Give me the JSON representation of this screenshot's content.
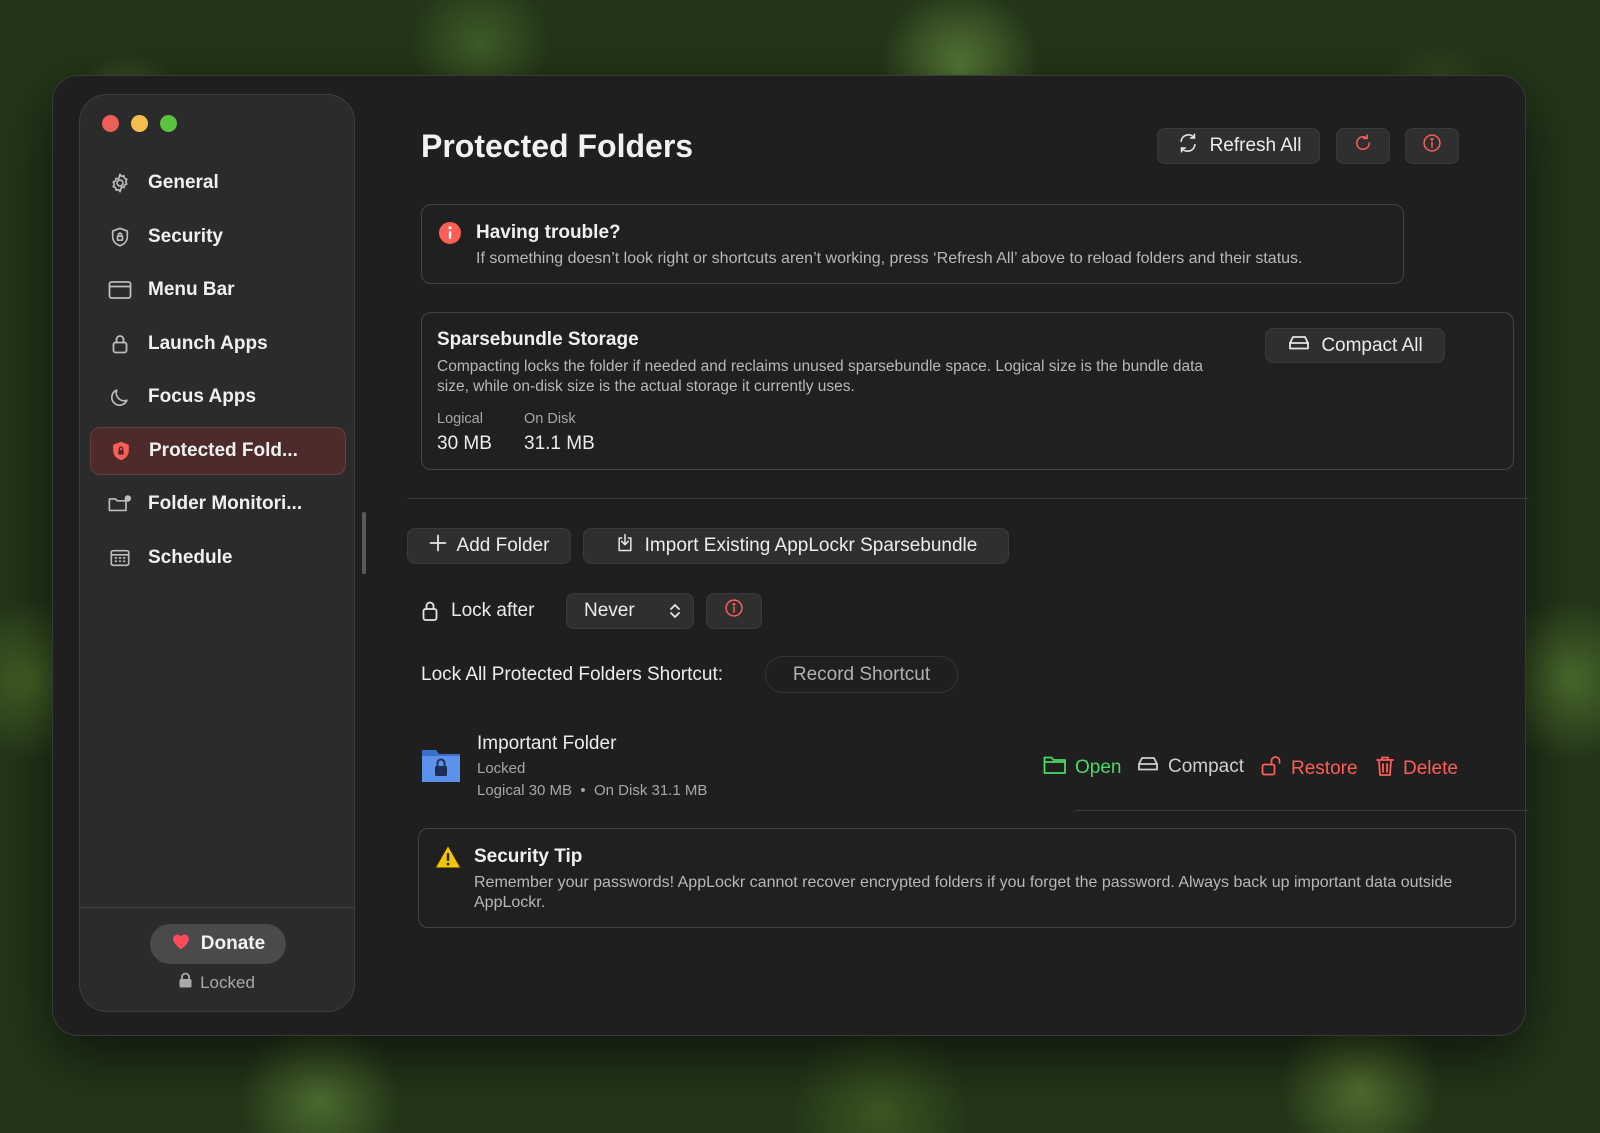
{
  "sidebar": {
    "items": [
      {
        "label": "General",
        "icon": "gear-icon"
      },
      {
        "label": "Security",
        "icon": "shield-icon"
      },
      {
        "label": "Menu Bar",
        "icon": "menubar-icon"
      },
      {
        "label": "Launch Apps",
        "icon": "lock-icon"
      },
      {
        "label": "Focus Apps",
        "icon": "moon-icon"
      },
      {
        "label": "Protected Fold...",
        "icon": "shield-lock-icon",
        "active": true
      },
      {
        "label": "Folder Monitori...",
        "icon": "folder-monitor-icon"
      },
      {
        "label": "Schedule",
        "icon": "calendar-icon"
      }
    ],
    "donate_label": "Donate",
    "status_label": "Locked"
  },
  "header": {
    "title": "Protected Folders",
    "refresh_all_label": "Refresh All"
  },
  "trouble": {
    "title": "Having trouble?",
    "text": "If something doesn’t look right or shortcuts aren’t working, press ‘Refresh All’ above to reload folders and their status."
  },
  "storage": {
    "title": "Sparsebundle Storage",
    "text": "Compacting locks the folder if needed and reclaims unused sparsebundle space. Logical size is the bundle data size, while on-disk size is the actual storage it currently uses.",
    "compact_all_label": "Compact All",
    "logical_label": "Logical",
    "logical_value": "30 MB",
    "ondisk_label": "On Disk",
    "ondisk_value": "31.1 MB"
  },
  "actions": {
    "add_folder_label": "Add Folder",
    "import_label": "Import Existing AppLockr Sparsebundle"
  },
  "lock_after": {
    "label": "Lock after",
    "value": "Never"
  },
  "shortcut": {
    "label": "Lock All Protected Folders Shortcut:",
    "button_label": "Record Shortcut"
  },
  "folder": {
    "name": "Important Folder",
    "status": "Locked",
    "sizes": "Logical 30 MB  •  On Disk 31.1 MB",
    "open_label": "Open",
    "compact_label": "Compact",
    "restore_label": "Restore",
    "delete_label": "Delete"
  },
  "tip": {
    "title": "Security Tip",
    "text": "Remember your passwords! AppLockr cannot recover encrypted folders if you forget the password. Always back up important data outside AppLockr."
  },
  "colors": {
    "accent_red": "#ff5e57",
    "open_green": "#4cd964",
    "warning_yellow": "#f5c400"
  }
}
